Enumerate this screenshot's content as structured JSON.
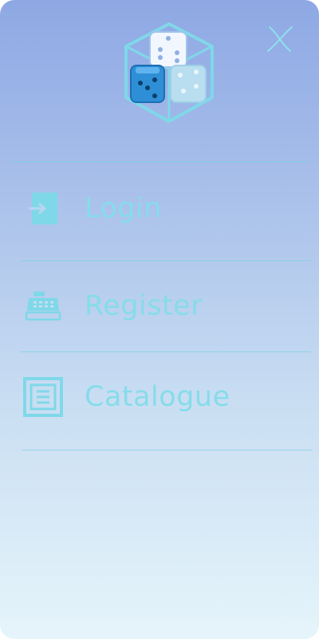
{
  "menu": {
    "items": [
      {
        "label": "Login",
        "icon": "login-icon"
      },
      {
        "label": "Register",
        "icon": "cash-register-icon"
      },
      {
        "label": "Catalogue",
        "icon": "catalogue-icon"
      }
    ]
  },
  "colors": {
    "accent": "#86dcea",
    "icon": "#7fd8e8",
    "gradient_top": "#8ea8e4",
    "gradient_bottom": "#e6f5fb",
    "logo_die_dark": "#2e8fd6"
  }
}
